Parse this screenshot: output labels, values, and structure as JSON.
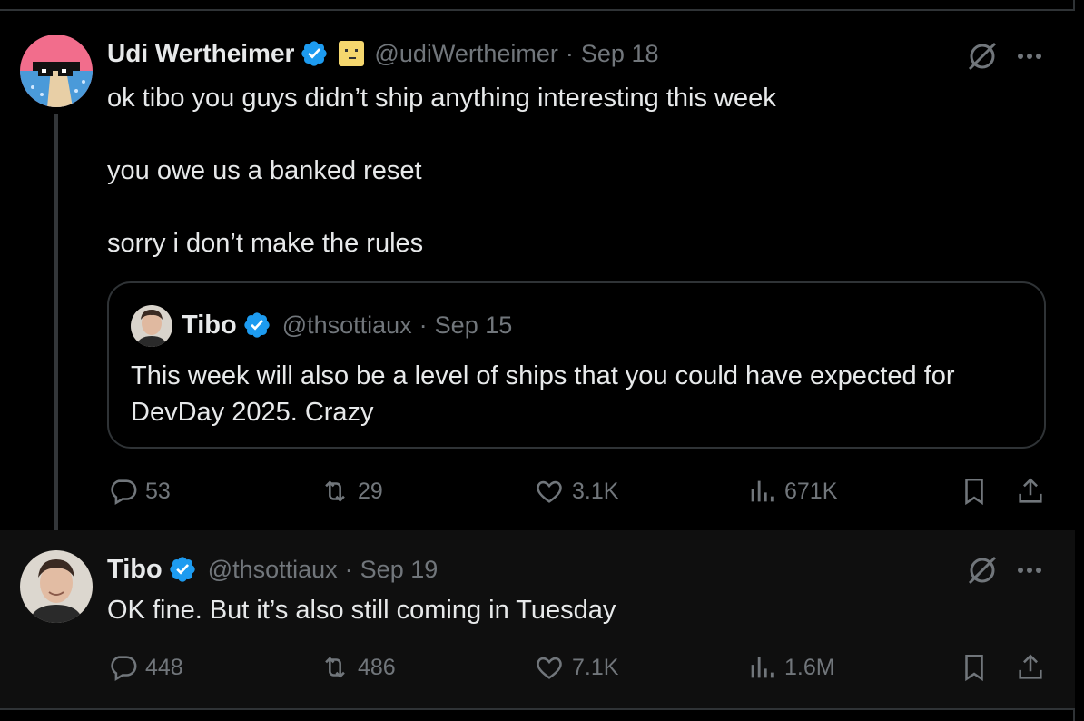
{
  "tweet1": {
    "name": "Udi Wertheimer",
    "handle": "@udiWertheimer",
    "sep": "·",
    "date": "Sep 18",
    "lines": [
      "ok tibo you guys didn’t ship anything interesting this week",
      "you owe us a banked reset",
      "sorry i don’t make the rules"
    ],
    "quote": {
      "name": "Tibo",
      "handle": "@thsottiaux",
      "sep": "·",
      "date": "Sep 15",
      "text_line1": "This week will also be a level of ships that you could have expected for",
      "text_line2": "DevDay 2025. Crazy"
    },
    "replies": "53",
    "reposts": "29",
    "likes": "3.1K",
    "views": "671K"
  },
  "tweet2": {
    "name": "Tibo",
    "handle": "@thsottiaux",
    "sep": "·",
    "date": "Sep 19",
    "text": "OK fine. But it’s also still coming in Tuesday",
    "replies": "448",
    "reposts": "486",
    "likes": "7.1K",
    "views": "1.6M"
  },
  "colors": {
    "verified": "#1d9bf0",
    "muted": "#71767b",
    "text": "#e7e9ea",
    "border": "#2f3336"
  },
  "icons": [
    "verified-badge-icon",
    "emoji-badge-icon",
    "grok-icon",
    "more-icon",
    "reply-icon",
    "repost-icon",
    "like-icon",
    "views-icon",
    "bookmark-icon",
    "share-icon"
  ]
}
